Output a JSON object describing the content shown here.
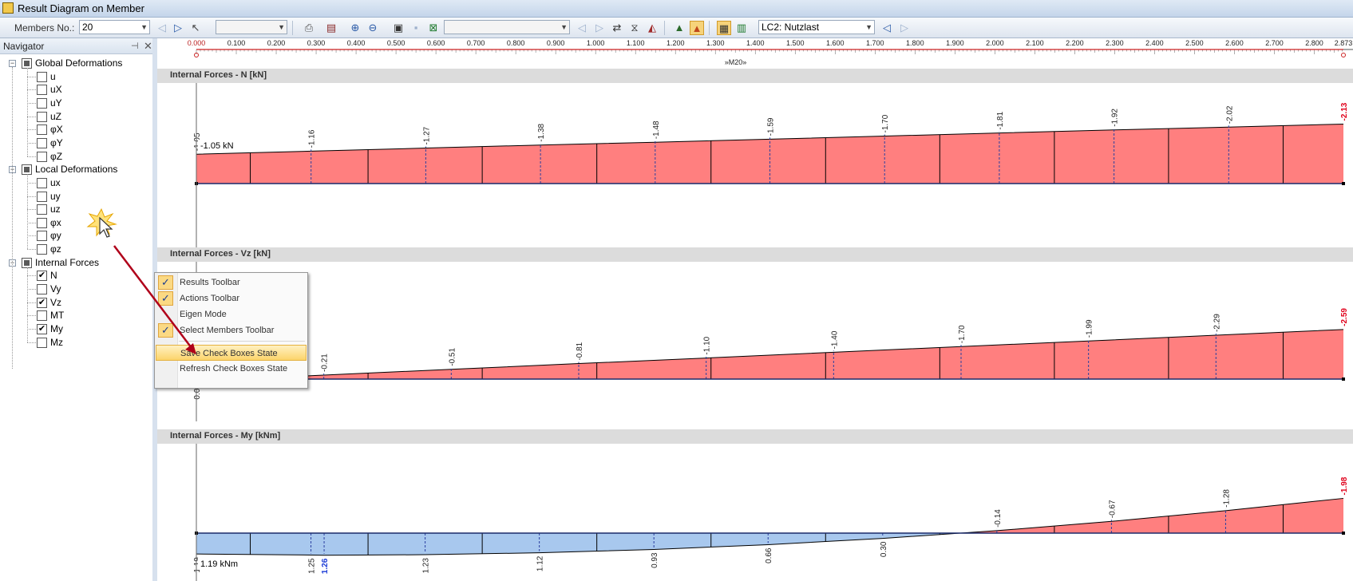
{
  "window": {
    "title": "Result Diagram on Member"
  },
  "toolbar": {
    "members_label": "Members No.:",
    "members_value": "20",
    "loadcase_value": "LC2: Nutzlast",
    "icons": [
      "prev-arrow",
      "next-arrow",
      "select-member",
      "print",
      "color-scale",
      "zoom-in",
      "zoom-out",
      "export",
      "save",
      "excel",
      "prev-arrow",
      "next-arrow",
      "show-values",
      "show-extremes",
      "show-fill",
      "render-a",
      "render-b",
      "member-table",
      "values-table"
    ]
  },
  "navigator": {
    "title": "Navigator",
    "groups": [
      {
        "label": "Global Deformations",
        "state": "partial",
        "items": [
          {
            "label": "u",
            "checked": false
          },
          {
            "label": "uX",
            "checked": false
          },
          {
            "label": "uY",
            "checked": false
          },
          {
            "label": "uZ",
            "checked": false
          },
          {
            "label": "φX",
            "checked": false
          },
          {
            "label": "φY",
            "checked": false
          },
          {
            "label": "φZ",
            "checked": false
          }
        ]
      },
      {
        "label": "Local Deformations",
        "state": "partial",
        "items": [
          {
            "label": "ux",
            "checked": false
          },
          {
            "label": "uy",
            "checked": false
          },
          {
            "label": "uz",
            "checked": false
          },
          {
            "label": "φx",
            "checked": false
          },
          {
            "label": "φy",
            "checked": false
          },
          {
            "label": "φz",
            "checked": false
          }
        ]
      },
      {
        "label": "Internal Forces",
        "state": "partial",
        "items": [
          {
            "label": "N",
            "checked": true
          },
          {
            "label": "Vy",
            "checked": false
          },
          {
            "label": "Vz",
            "checked": true
          },
          {
            "label": "MT",
            "checked": false
          },
          {
            "label": "My",
            "checked": true
          },
          {
            "label": "Mz",
            "checked": false
          }
        ]
      }
    ]
  },
  "ruler": {
    "ticks": [
      "0.000",
      "0.100",
      "0.200",
      "0.300",
      "0.400",
      "0.500",
      "0.600",
      "0.700",
      "0.800",
      "0.900",
      "1.000",
      "1.100",
      "1.200",
      "1.300",
      "1.400",
      "1.500",
      "1.600",
      "1.700",
      "1.800",
      "1.900",
      "2.000",
      "2.100",
      "2.200",
      "2.300",
      "2.400",
      "2.500",
      "2.600",
      "2.700",
      "2.800",
      "2.873"
    ],
    "member_label": "»M20»"
  },
  "diagrams": [
    {
      "title": "Internal Forces - N [kN]",
      "start_label": "-1.05 kN",
      "values": [
        "-1.05",
        "-1.16",
        "-1.27",
        "-1.38",
        "-1.48",
        "-1.59",
        "-1.70",
        "-1.81",
        "-1.92",
        "-2.02",
        "-2.13"
      ]
    },
    {
      "title": "Internal Forces - Vz [kN]",
      "values": [
        "0.09",
        "-0.21",
        "-0.51",
        "-0.81",
        "-1.10",
        "-1.40",
        "-1.70",
        "-1.99",
        "-2.29",
        "-2.59"
      ]
    },
    {
      "title": "Internal Forces - My [kNm]",
      "start_label": "1.19 kNm",
      "values": [
        "1.19",
        "1.25",
        "1.26",
        "1.23",
        "1.12",
        "0.93",
        "0.66",
        "0.30",
        "-0.14",
        "-0.67",
        "-1.28",
        "-1.98"
      ]
    }
  ],
  "context_menu": {
    "items": [
      {
        "label": "Results Toolbar",
        "checked": true
      },
      {
        "label": "Actions Toolbar",
        "checked": true
      },
      {
        "label": "Eigen Mode",
        "checked": false
      },
      {
        "label": "Select Members Toolbar",
        "checked": true
      },
      {
        "label": "Save Check Boxes State",
        "checked": false,
        "highlighted": true
      },
      {
        "label": "Refresh Check Boxes State",
        "checked": false
      }
    ]
  },
  "colors": {
    "positive_fill": "#ff7f7f",
    "negative_fill": "#a8c8ee",
    "max_label": "#e0001b",
    "min_label": "#1a3ad6",
    "annotation_arrow": "#b0001a"
  }
}
